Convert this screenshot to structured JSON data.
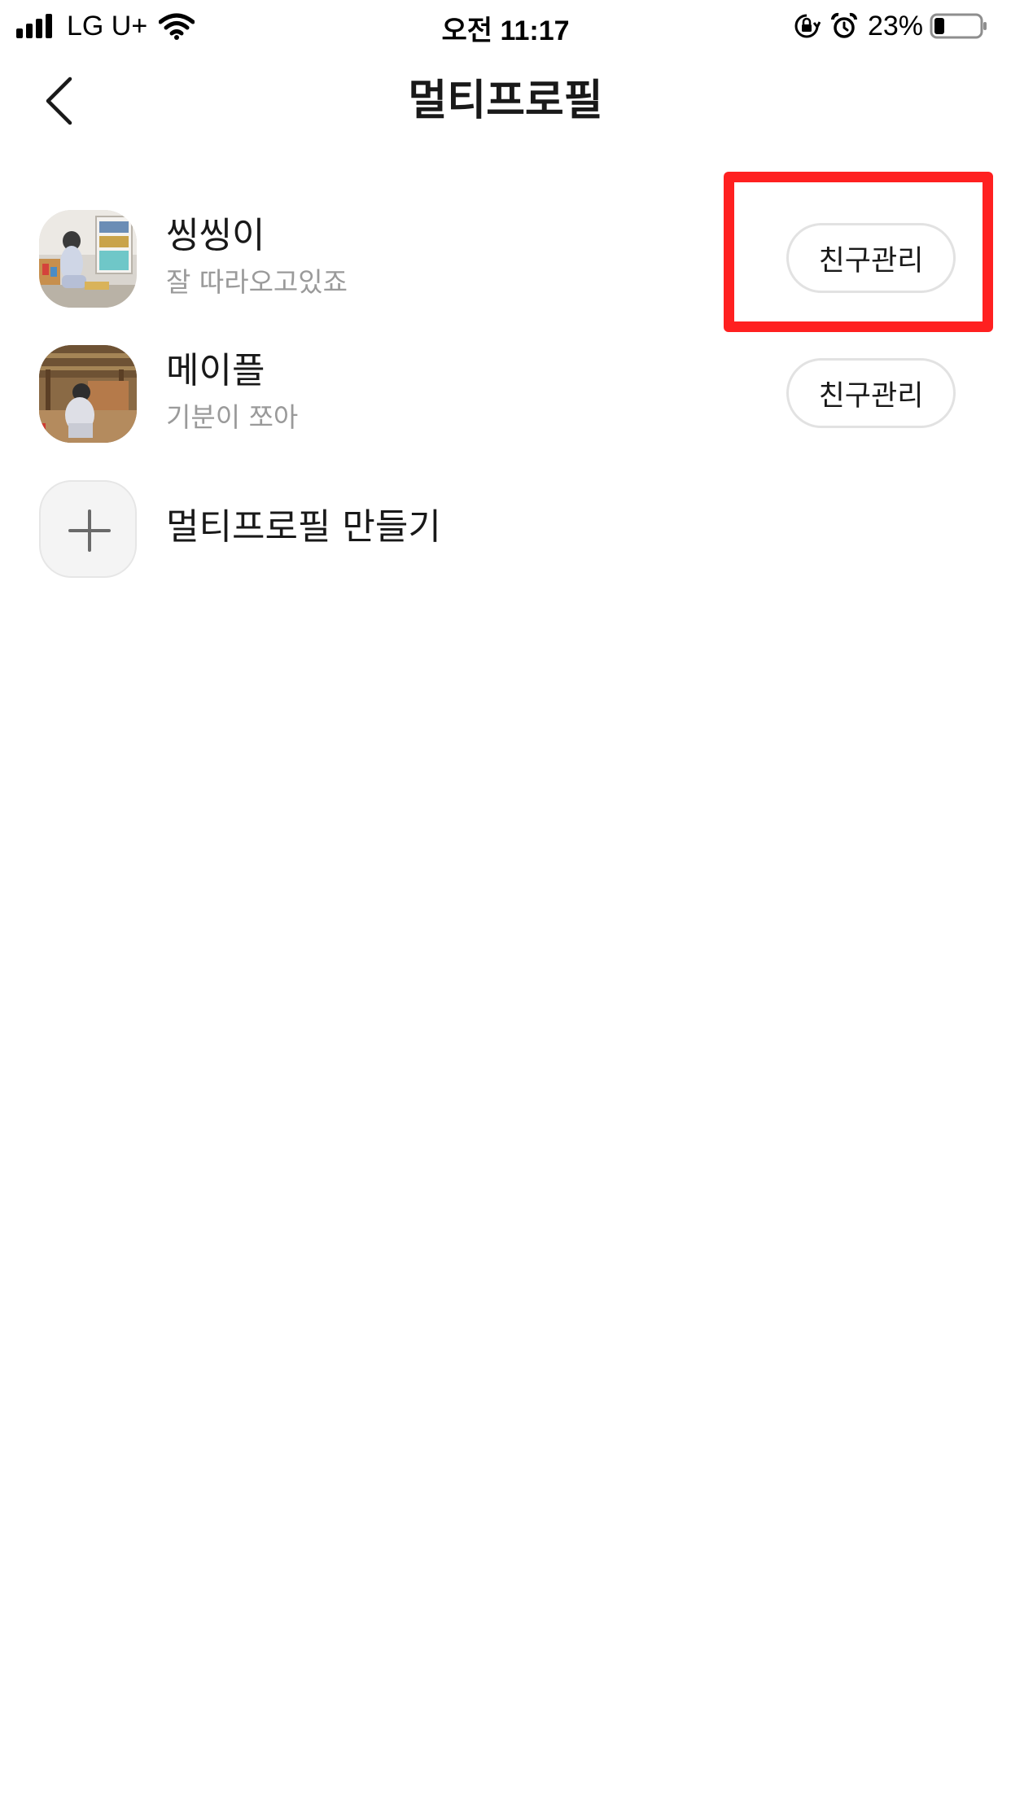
{
  "status_bar": {
    "carrier": "LG U+",
    "time": "오전 11:17",
    "battery_percent": "23%",
    "battery_level": 0.23,
    "icons": [
      "signal-icon",
      "wifi-icon",
      "rotation-lock-icon",
      "alarm-icon",
      "battery-icon"
    ]
  },
  "header": {
    "back_icon": "chevron-left-icon",
    "title": "멀티프로필"
  },
  "profiles": [
    {
      "name": "씽씽이",
      "status": "잘 따라오고있죠",
      "button_label": "친구관리"
    },
    {
      "name": "메이플",
      "status": "기분이 쪼아",
      "button_label": "친구관리"
    }
  ],
  "add_profile": {
    "icon": "plus-icon",
    "label": "멀티프로필 만들기"
  },
  "colors": {
    "highlight": "#ff2020",
    "button_border": "#e2e2e2",
    "secondary_text": "#9a9a9a"
  }
}
